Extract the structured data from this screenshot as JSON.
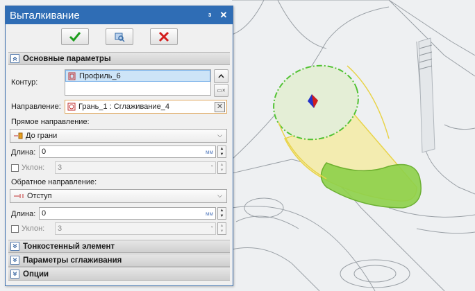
{
  "panel": {
    "title": "Выталкивание",
    "pin_icon": "pin-icon",
    "close_icon": "close-icon",
    "actions": [
      "ok-check-icon",
      "preview-icon",
      "cancel-x-icon"
    ]
  },
  "main_section": {
    "title": "Основные параметры",
    "contour_label": "Контур:",
    "contour_item": "Профиль_6",
    "direction_label": "Направление:",
    "direction_value": "Грань_1 : Сглаживание_4",
    "forward_label": "Прямое направление:",
    "forward_mode": "До грани",
    "length1_label": "Длина:",
    "length1_value": "0",
    "unit_mm": "мм",
    "slope1_label": "Уклон:",
    "slope1_value": "3",
    "unit_deg": "°",
    "reverse_label": "Обратное направление:",
    "reverse_mode": "Отступ",
    "length2_label": "Длина:",
    "length2_value": "0",
    "slope2_label": "Уклон:",
    "slope2_value": "3"
  },
  "sections": {
    "thin_wall": "Тонкостенный элемент",
    "smoothing": "Параметры сглаживания",
    "options": "Опции"
  },
  "colors": {
    "title_bar": "#2f6db5",
    "feature_green": "#8ed14a",
    "accent_yellow": "#e8d34a"
  }
}
